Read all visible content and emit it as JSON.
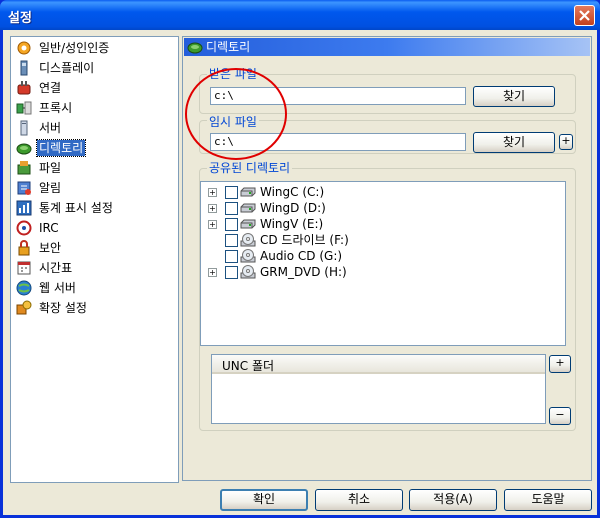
{
  "window": {
    "title": "설정"
  },
  "nav": {
    "items": [
      {
        "label": "일반/성인인증",
        "icon": "settings-gear-icon"
      },
      {
        "label": "디스플레이",
        "icon": "display-icon"
      },
      {
        "label": "연결",
        "icon": "connection-icon"
      },
      {
        "label": "프록시",
        "icon": "proxy-icon"
      },
      {
        "label": "서버",
        "icon": "server-icon"
      },
      {
        "label": "디렉토리",
        "icon": "directory-icon",
        "selected": true
      },
      {
        "label": "파일",
        "icon": "file-icon"
      },
      {
        "label": "알림",
        "icon": "notification-icon"
      },
      {
        "label": "통계 표시 설정",
        "icon": "statistics-icon"
      },
      {
        "label": "IRC",
        "icon": "irc-icon"
      },
      {
        "label": "보안",
        "icon": "security-lock-icon"
      },
      {
        "label": "시간표",
        "icon": "calendar-icon"
      },
      {
        "label": "웹 서버",
        "icon": "web-server-icon"
      },
      {
        "label": "확장 설정",
        "icon": "extension-icon"
      }
    ]
  },
  "panel": {
    "title": "디렉토리",
    "downloads": {
      "label": "받은 파일",
      "value": "c:\\",
      "browse": "찾기"
    },
    "temp": {
      "label": "임시 파일",
      "value": "c:\\",
      "browse": "찾기",
      "extra": "+"
    },
    "shared": {
      "label": "공유된 디렉토리",
      "drives": [
        {
          "label": "WingC (C:)",
          "expandable": true,
          "icon": "hard-drive-icon"
        },
        {
          "label": "WingD (D:)",
          "expandable": true,
          "icon": "hard-drive-icon"
        },
        {
          "label": "WingV (E:)",
          "expandable": true,
          "icon": "hard-drive-icon"
        },
        {
          "label": "CD 드라이브 (F:)",
          "expandable": false,
          "icon": "cd-drive-icon"
        },
        {
          "label": "Audio CD (G:)",
          "expandable": false,
          "icon": "cd-drive-icon"
        },
        {
          "label": "GRM_DVD (H:)",
          "expandable": true,
          "icon": "cd-drive-icon"
        }
      ],
      "expand_symbol": "+",
      "unc_header": "UNC 폴더",
      "unc_add": "+",
      "unc_remove": "−"
    }
  },
  "buttons": {
    "ok": "확인",
    "cancel": "취소",
    "apply": "적용(A)",
    "help": "도움말"
  },
  "colors": {
    "title_bar": "#0054e3",
    "selection": "#316ac5",
    "group_label": "#0046d5",
    "annotation_circle": "#e00000"
  }
}
